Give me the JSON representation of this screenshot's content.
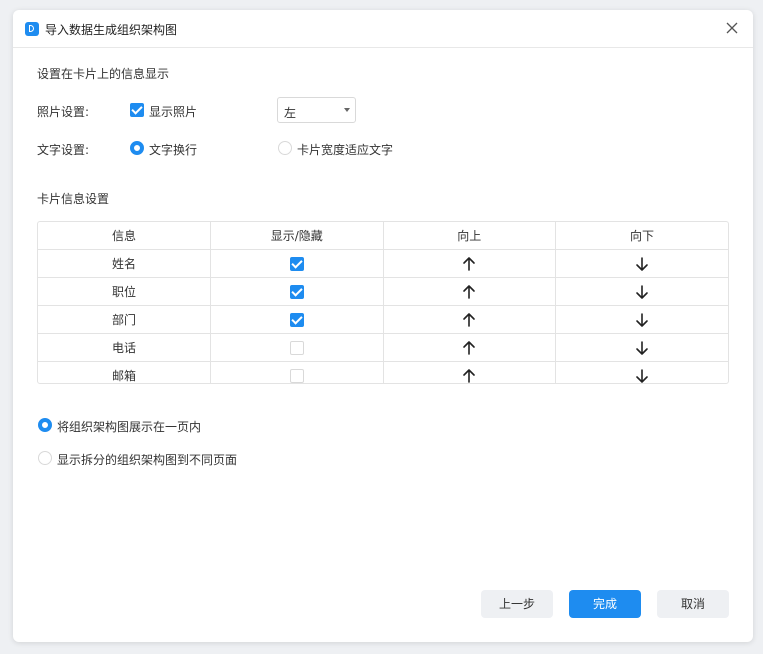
{
  "dialog": {
    "title": "导入数据生成组织架构图"
  },
  "card_display": {
    "section_title": "设置在卡片上的信息显示",
    "photo": {
      "label": "照片设置:",
      "checkbox_label": "显示照片",
      "checked": true,
      "position_select": "左"
    },
    "text": {
      "label": "文字设置:",
      "options": [
        {
          "label": "文字换行",
          "selected": true
        },
        {
          "label": "卡片宽度适应文字",
          "selected": false
        }
      ]
    }
  },
  "card_info": {
    "section_title": "卡片信息设置",
    "columns": [
      "信息",
      "显示/隐藏",
      "向上",
      "向下"
    ],
    "rows": [
      {
        "name": "姓名",
        "visible": true
      },
      {
        "name": "职位",
        "visible": true
      },
      {
        "name": "部门",
        "visible": true
      },
      {
        "name": "电话",
        "visible": false
      },
      {
        "name": "邮箱",
        "visible": false
      }
    ]
  },
  "layout_options": [
    {
      "label": "将组织架构图展示在一页内",
      "selected": true
    },
    {
      "label": "显示拆分的组织架构图到不同页面",
      "selected": false
    }
  ],
  "buttons": {
    "prev": "上一步",
    "finish": "完成",
    "cancel": "取消"
  },
  "colors": {
    "accent": "#1e8cf0",
    "button_gray": "#eef0f3"
  },
  "icons": {
    "up": "arrow-up-icon",
    "down": "arrow-down-icon",
    "close": "close-icon"
  }
}
